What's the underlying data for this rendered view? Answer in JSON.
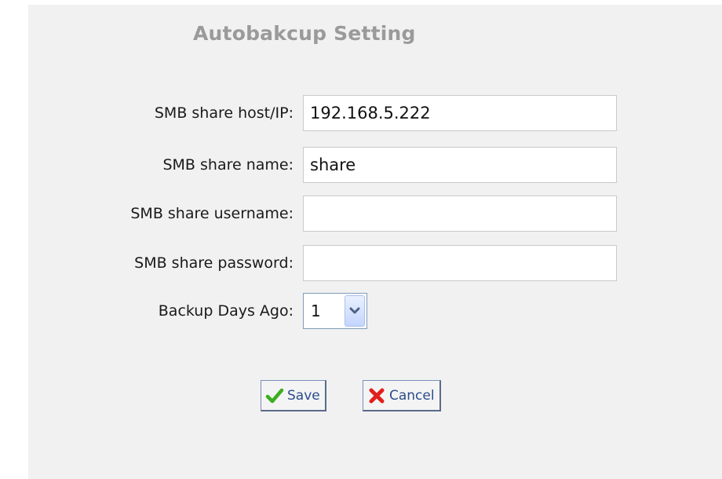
{
  "title": "Autobakcup Setting",
  "fields": {
    "host": {
      "label": "SMB share host/IP:",
      "value": "192.168.5.222"
    },
    "share": {
      "label": "SMB share name:",
      "value": "share"
    },
    "username": {
      "label": "SMB share username:",
      "value": ""
    },
    "password": {
      "label": "SMB share password:",
      "value": ""
    }
  },
  "backup_days": {
    "label": "Backup Days Ago:",
    "selected": "1"
  },
  "buttons": {
    "save_label": "Save",
    "cancel_label": "Cancel"
  },
  "icons": {
    "save": "check-icon",
    "cancel": "x-icon",
    "dropdown": "chevron-down-icon"
  },
  "colors": {
    "panel_bg": "#f1f1f1",
    "title": "#9a9a9a",
    "check": "#3cae1e",
    "cross": "#e0201c"
  }
}
